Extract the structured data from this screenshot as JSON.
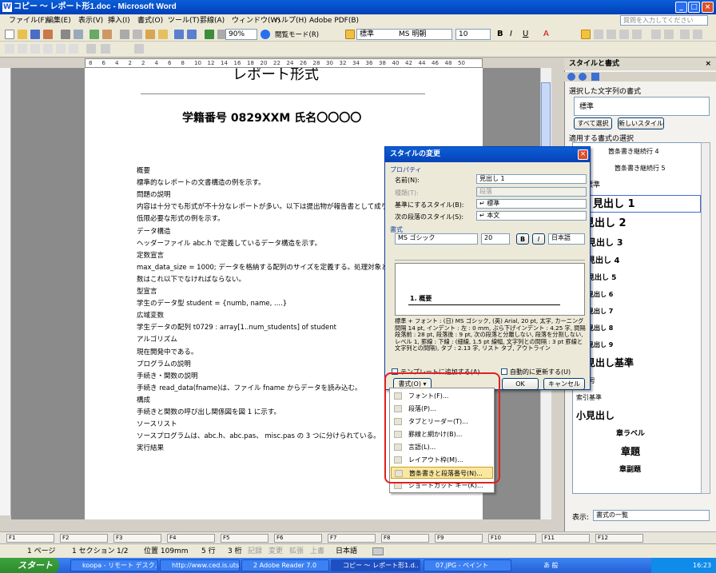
{
  "window": {
    "title": "コピー ～ レポート形1.doc - Microsoft Word"
  },
  "menu": [
    "ファイル(F)",
    "編集(E)",
    "表示(V)",
    "挿入(I)",
    "書式(O)",
    "ツール(T)",
    "罫線(A)",
    "ウィンドウ(W)",
    "ヘルプ(H)",
    "Adobe PDF(B)"
  ],
  "help_box": {
    "placeholder": "質問を入力してください"
  },
  "toolbar": {
    "zoom": "90%",
    "reading_mode": "閲覧モード(R)",
    "style": "標準",
    "font": "MS 明朝",
    "size": "10"
  },
  "ruler_ticks": [
    "8",
    "6",
    "4",
    "2",
    "2",
    "4",
    "6",
    "8",
    "10",
    "12",
    "14",
    "16",
    "18",
    "20",
    "22",
    "24",
    "26",
    "28",
    "30",
    "32",
    "34",
    "36",
    "38",
    "40",
    "42",
    "44",
    "46",
    "48",
    "50"
  ],
  "document": {
    "title": "レポート形式",
    "subtitle": "学籍番号 0829XXM  氏名〇〇〇〇",
    "lines": [
      "概要",
      "標準的なレポートの文書構造の例を示す。",
      "問題の説明",
      "内容は十分でも形式が不十分なレポートが多い。以下は提出物が報告書として成り",
      "低限必要な形式の例を示す。",
      "データ構造",
      "ヘッダーファイル abc.h で定義しているデータ構造を示す。",
      "定数宣言",
      "max_data_size = 1000; データを格納する配列のサイズを定義する。処理対象とな",
      "数はこれ以下でなければならない。",
      "型宣言",
      "学生のデータ型  student = {numb, name, ....}",
      "広域変数",
      "学生データの配列  t0729 : array[1..num_students] of student",
      "アルゴリズム",
      "現在開発中である。",
      "プログラムの説明",
      "手続き・関数の説明",
      "手続き read_data(fname)は、ファイル fname からデータを読み込む。",
      "構成",
      "手続きと関数の呼び出し関係図を図 1 に示す。",
      "ソースリスト",
      "ソースプログラムは、abc.h、abc.pas、 misc.pas の 3 つに分けられている。",
      "実行結果"
    ]
  },
  "pane": {
    "title": "スタイルと書式",
    "selected_label": "選択した文字列の書式",
    "selected_value": "標準",
    "select_all": "すべて選択",
    "new_style": "新しいスタイル",
    "apply_label": "適用する書式の選択",
    "styles": [
      "箇条書き継続行 4",
      "箇条書き継続行 5",
      "標準",
      "見出し 1",
      "見出し 2",
      "見出し 3",
      "見出し 4",
      "見出し 5",
      "見出し 6",
      "見出し 7",
      "見出し 8",
      "見出し 9",
      "見出し基準",
      "行番号",
      "索引基準",
      "小見出し",
      "章ラベル",
      "章題",
      "章副題"
    ],
    "show_label": "表示:",
    "show_value": "書式の一覧"
  },
  "dialog": {
    "title": "スタイルの変更",
    "properties": "プロパティ",
    "name_label": "名前(N):",
    "name_value": "見出し 1",
    "type_label": "種類(T):",
    "type_value": "段落",
    "base_label": "基準にするスタイル(B):",
    "base_value": "↵ 標準",
    "next_label": "次の段落のスタイル(S):",
    "next_value": "↵ 本文",
    "format_label": "書式",
    "font": "MS ゴシック",
    "size": "20",
    "lang": "日本語",
    "preview_heading": "1. 概要",
    "description": "標準 + フォント : (日) MS ゴシック, (英) Arial, 20 pt, 太字, カーニング間隔 14 pt, インデント : 左 : 0 mm, ぶら下げインデント : 4.25 字, 間隔 段落前 : 28 pt, 段落後 : 9 pt, 次の段落と分離しない, 段落を分割しない, レベル 1, 罫線 : 下線 : (細線, 1.5 pt 線幅, 文字列との間隔 : 3 pt 罫線と文字列との間隔), タブ : 2.13 字, リスト タブ, アウトライン",
    "add_template": "テンプレートに追加する(A)",
    "auto_update": "自動的に更新する(U)",
    "format_button": "書式(O) ▾",
    "ok": "OK",
    "cancel": "キャンセル"
  },
  "format_menu": [
    "フォント(F)...",
    "段落(P)...",
    "タブとリーダー(T)...",
    "罫線と網かけ(B)...",
    "言語(L)...",
    "レイアウト枠(M)...",
    "箇条書きと段落番号(N)...",
    "ショートカット キー(K)..."
  ],
  "fkeys": [
    "F1",
    "F2",
    "F3",
    "F4",
    "F5",
    "F6",
    "F7",
    "F8",
    "F9",
    "F10",
    "F11",
    "F12"
  ],
  "status": {
    "page": "1 ページ",
    "section": "1 セクション",
    "pages": "1/2",
    "pos": "位置 109mm",
    "line": "5 行",
    "col": "3 桁",
    "rec": "記録",
    "trk": "変更",
    "ext": "拡張",
    "ovr": "上書",
    "lang": "日本語"
  },
  "taskbar": {
    "start": "スタート",
    "tasks": [
      "koopa - リモート デスク..",
      "http://www.ced.is.uts..",
      "2 Adobe Reader 7.0",
      "コピー ～ レポート形1.d..",
      "07.JPG - ペイント"
    ],
    "ime": "あ 般",
    "clock": "16:23"
  }
}
